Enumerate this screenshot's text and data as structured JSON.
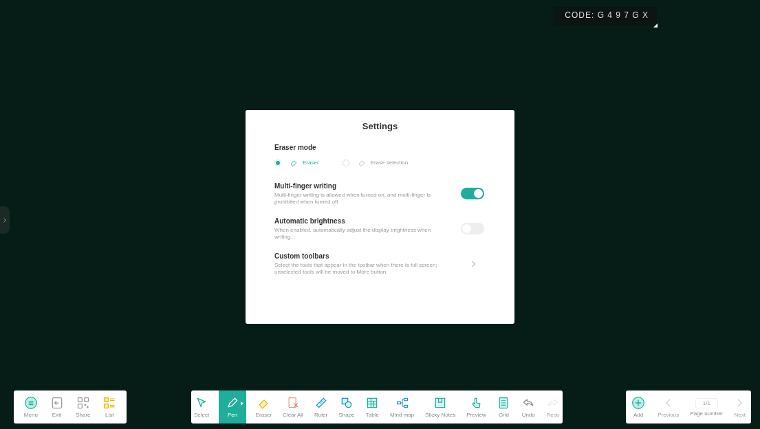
{
  "code_badge": {
    "text": "CODE: G 4 9 7 G X"
  },
  "settings": {
    "title": "Settings",
    "eraser_mode": {
      "label": "Eraser mode",
      "options": [
        {
          "label": "Eraser",
          "selected": true
        },
        {
          "label": "Erase selection",
          "selected": false
        }
      ]
    },
    "items": [
      {
        "kind": "toggle",
        "title": "Multi-finger writing",
        "description": "Multi-finger writing is allowed when turned on, and multi-finger is prohibited when turned off.",
        "on": true
      },
      {
        "kind": "toggle",
        "title": "Automatic brightness",
        "description": "When enabled, automatically adjust the display brightness when writing.",
        "on": false
      },
      {
        "kind": "link",
        "title": "Custom toolbars",
        "description": "Select the tools that appear in the toolbar when there is full screen; unselected tools will be moved to More button."
      }
    ]
  },
  "left_toolbar": [
    {
      "label": "Menu"
    },
    {
      "label": "Exit"
    },
    {
      "label": "Share"
    },
    {
      "label": "List"
    }
  ],
  "main_toolbar": [
    {
      "label": "Select",
      "selected": false,
      "disabled": false
    },
    {
      "label": "Pen",
      "selected": true,
      "disabled": false
    },
    {
      "label": "Eraser",
      "selected": false,
      "disabled": false
    },
    {
      "label": "Clear All",
      "selected": false,
      "disabled": false
    },
    {
      "label": "Ruler",
      "selected": false,
      "disabled": false
    },
    {
      "label": "Shape",
      "selected": false,
      "disabled": false
    },
    {
      "label": "Table",
      "selected": false,
      "disabled": false
    },
    {
      "label": "Mind map",
      "selected": false,
      "disabled": false
    },
    {
      "label": "Sticky Notes",
      "selected": false,
      "disabled": false
    },
    {
      "label": "Preview",
      "selected": false,
      "disabled": false
    },
    {
      "label": "Grid",
      "selected": false,
      "disabled": false
    },
    {
      "label": "Undo",
      "selected": false,
      "disabled": false
    },
    {
      "label": "Redo",
      "selected": false,
      "disabled": true
    }
  ],
  "page_toolbar": {
    "add": {
      "label": "Add"
    },
    "previous": {
      "label": "Previous",
      "disabled": true
    },
    "page_number": {
      "value": "1/1",
      "label": "Page number"
    },
    "next": {
      "label": "Next",
      "disabled": true
    }
  }
}
